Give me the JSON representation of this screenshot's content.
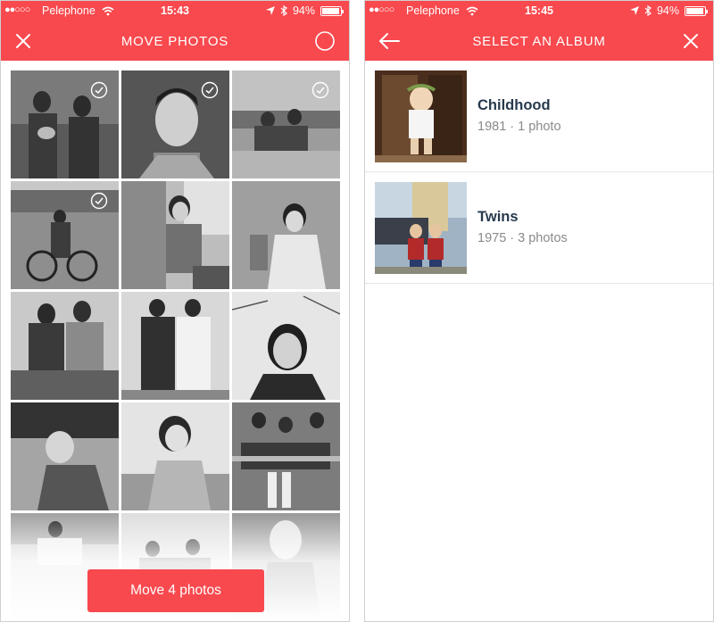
{
  "left_screen": {
    "status_bar": {
      "carrier": "Pelephone",
      "time": "15:43",
      "battery": "94%"
    },
    "title": "MOVE PHOTOS",
    "close_icon": "close-icon",
    "select_all_icon": "circle-icon",
    "selected_photos": 4,
    "move_button_label": "Move 4 photos"
  },
  "right_screen": {
    "status_bar": {
      "carrier": "Pelephone",
      "time": "15:45",
      "battery": "94%"
    },
    "title": "SELECT AN ALBUM",
    "back_icon": "back-arrow-icon",
    "close_icon": "close-icon",
    "albums": [
      {
        "name": "Childhood",
        "meta": "1981 · 1 photo"
      },
      {
        "name": "Twins",
        "meta": "1975 · 3 photos"
      }
    ]
  },
  "colors": {
    "accent": "#f8494e",
    "album_name": "#283a4e",
    "meta": "#8a8a8a"
  }
}
